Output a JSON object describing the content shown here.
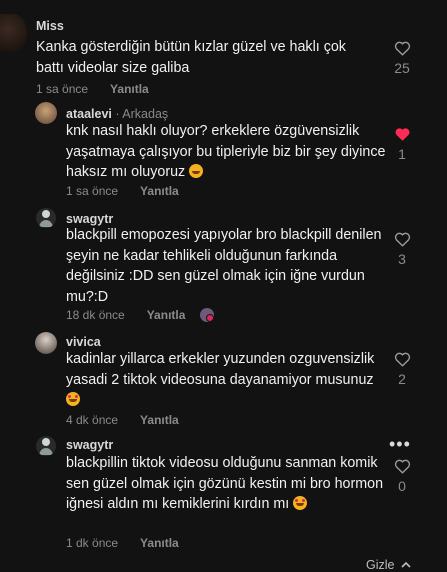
{
  "comments": [
    {
      "user": "Miss",
      "text": "Kanka gösterdiğin bütün kızlar güzel ve haklı çok battı videolar size galiba",
      "time": "1 sa önce",
      "reply_label": "Yanıtla",
      "likes": "25",
      "liked": false,
      "avatar_icon": "user-avatar-dark"
    },
    {
      "user": "ataalevi",
      "tag": "· Arkadaş",
      "text": "knk nasıl haklı oluyor? erkeklere özgüvensizlik yaşatmaya çalışıyor bu tipleriyle biz bir şey diyince haksız mı oluyoruz",
      "time": "1 sa önce",
      "reply_label": "Yanıtla",
      "likes": "1",
      "liked": true,
      "emoji": "grinning-face",
      "avatar_icon": "user-avatar-photo"
    },
    {
      "user": "swagytr",
      "text": "blackpill emopozesi yapıyolar bro blackpill denilen şeyin ne kadar tehlikeli olduğunun farkında değilsiniz :DD sen güzel olmak için iğne vurdun mu?:D",
      "time": "18 dk önce",
      "reply_label": "Yanıtla",
      "likes": "3",
      "liked": false,
      "avatar_icon": "user-avatar-figure"
    },
    {
      "user": "vivica",
      "text": "kadinlar yillarca erkekler yuzunden ozguvensizlik yasadi 2 tiktok videosuna dayanamiyor musunuz",
      "time": "4 dk önce",
      "reply_label": "Yanıtla",
      "likes": "2",
      "liked": false,
      "emoji": "heart-eyes-face",
      "avatar_icon": "user-avatar-photo"
    },
    {
      "user": "swagytr",
      "text": "blackpillin tiktok videosu olduğunu sanman komik sen güzel olmak için gözünü kestin mi bro hormon iğnesi aldın mı kemiklerini kırdın mı",
      "time": "1 dk önce",
      "reply_label": "Yanıtla",
      "likes": "0",
      "liked": false,
      "emoji": "smiling-hearts-face",
      "avatar_icon": "user-avatar-figure"
    }
  ],
  "hide_label": "Gizle",
  "colors": {
    "liked": "#fe2c55",
    "background": "#121212",
    "muted": "#8b8b8b"
  }
}
